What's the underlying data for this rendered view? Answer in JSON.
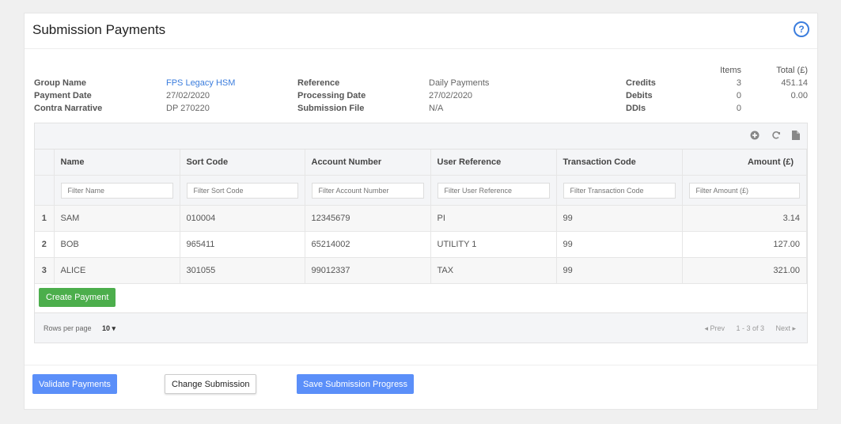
{
  "page": {
    "title": "Submission Payments",
    "help_icon": "?"
  },
  "summary": {
    "group_name_label": "Group Name",
    "group_name_value": "FPS Legacy HSM",
    "payment_date_label": "Payment Date",
    "payment_date_value": "27/02/2020",
    "contra_label": "Contra Narrative",
    "contra_value": "DP 270220",
    "reference_label": "Reference",
    "reference_value": "Daily Payments",
    "processing_label": "Processing Date",
    "processing_value": "27/02/2020",
    "file_label": "Submission File",
    "file_value": "N/A",
    "items_header": "Items",
    "total_header": "Total (£)",
    "credits_label": "Credits",
    "credits_items": "3",
    "credits_total": "451.14",
    "debits_label": "Debits",
    "debits_items": "0",
    "debits_total": "0.00",
    "ddis_label": "DDIs",
    "ddis_items": "0"
  },
  "toolbar": {
    "icons": [
      "plus-circle-icon",
      "refresh-icon",
      "file-icon"
    ]
  },
  "table": {
    "columns": [
      "Name",
      "Sort Code",
      "Account Number",
      "User Reference",
      "Transaction Code",
      "Amount (£)"
    ],
    "filters": [
      "Filter Name",
      "Filter Sort Code",
      "Filter Account Number",
      "Filter User Reference",
      "Filter Transaction Code",
      "Filter Amount (£)"
    ],
    "rows": [
      {
        "idx": "1",
        "name": "SAM",
        "sort": "010004",
        "account": "12345679",
        "ref": "PI",
        "code": "99",
        "amount": "3.14"
      },
      {
        "idx": "2",
        "name": "BOB",
        "sort": "965411",
        "account": "65214002",
        "ref": "UTILITY 1",
        "code": "99",
        "amount": "127.00"
      },
      {
        "idx": "3",
        "name": "ALICE",
        "sort": "301055",
        "account": "99012337",
        "ref": "TAX",
        "code": "99",
        "amount": "321.00"
      }
    ]
  },
  "actions": {
    "create_payment": "Create Payment"
  },
  "pager": {
    "rows_per_page_label": "Rows per page",
    "rows_per_page_value": "10 ▾",
    "prev": "◂ Prev",
    "range": "1 - 3 of 3",
    "next": "Next ▸"
  },
  "footer": {
    "validate": "Validate Payments",
    "change": "Change Submission",
    "save": "Save Submission Progress"
  },
  "colors": {
    "accent_blue": "#5b8ff9",
    "link_blue": "#3b7ddd",
    "green": "#4cae4c"
  }
}
